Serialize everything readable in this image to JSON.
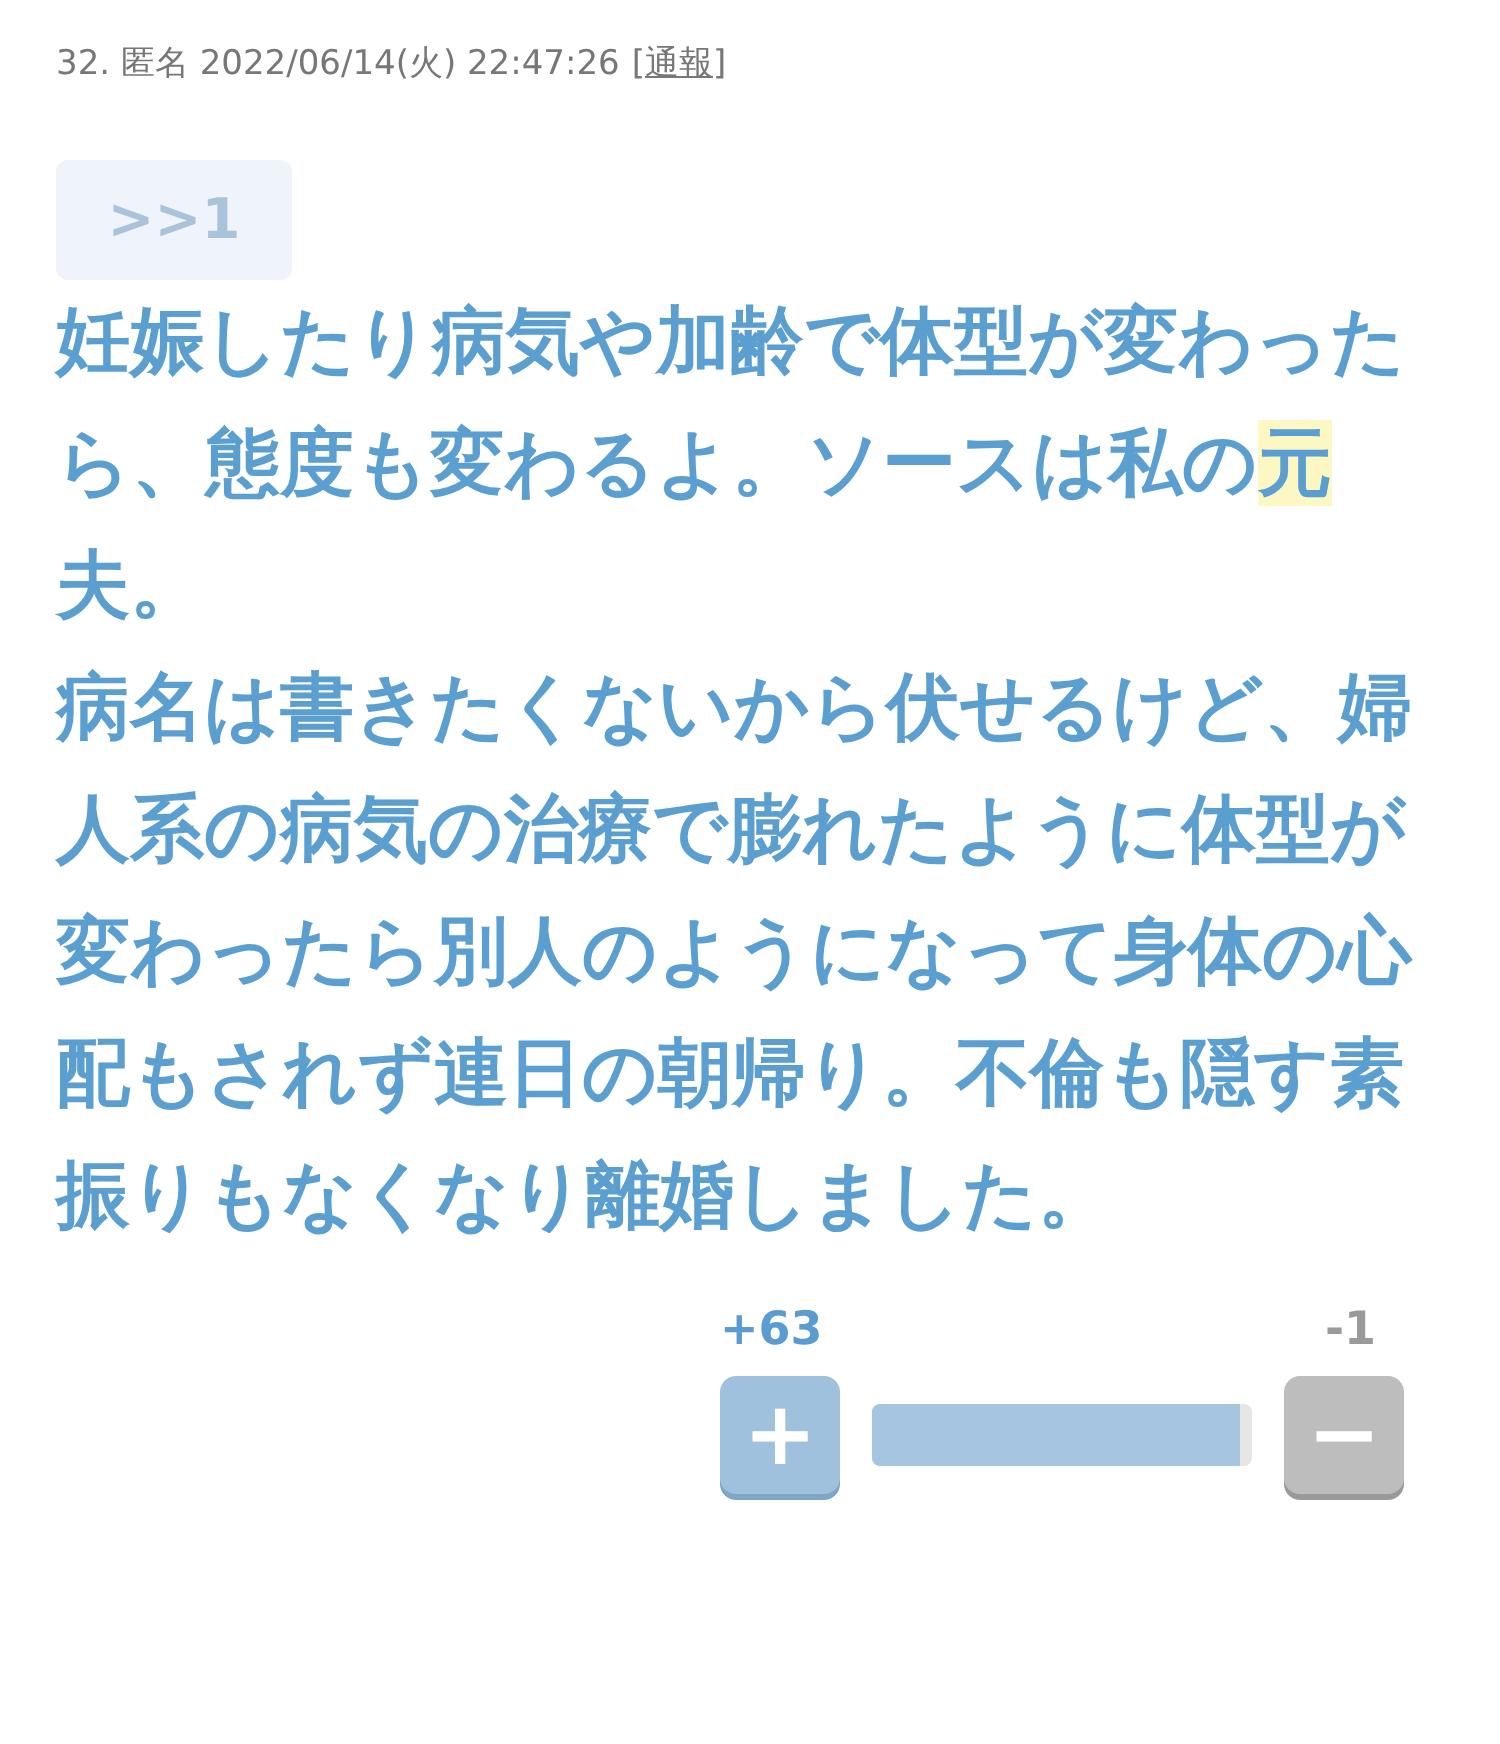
{
  "header": {
    "meta": "32. 匿名 2022/06/14(火) 22:47:26",
    "report": {
      "open": "[",
      "label": "通報",
      "close": "]"
    }
  },
  "anchor": ">>1",
  "body": [
    {
      "segments": [
        {
          "text": "妊娠したり病気や加齢で体型が変わったら、態度も変わるよ。ソースは私の",
          "highlighted": false
        },
        {
          "text": "元",
          "highlighted": true
        },
        {
          "text": "夫。",
          "highlighted": false
        }
      ]
    },
    {
      "segments": [
        {
          "text": "病名は書きたくないから伏せるけど、婦人系の病気の治療で膨れたように体型が変わったら別人のようになって身体の心配もされず連日の朝帰り。不倫も隠す素振りもなくなり離婚しました。",
          "highlighted": false
        }
      ]
    }
  ],
  "votes": {
    "plus_count": "+63",
    "minus_count": "-1",
    "plus_label": "+",
    "minus_label": "−",
    "level": 0.97
  }
}
